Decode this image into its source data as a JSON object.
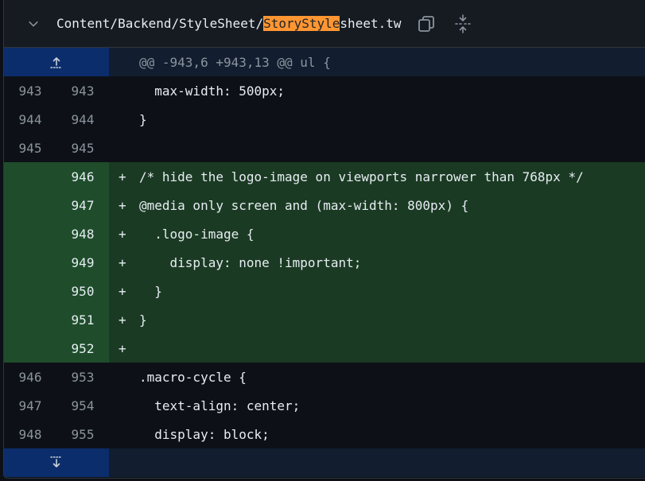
{
  "header": {
    "path_prefix": "Content/Backend/StyleSheet/",
    "path_highlight": "StoryStyle",
    "path_suffix": "sheet.tw",
    "icons": {
      "collapse": "chevron-down-icon",
      "copy": "copy-icon",
      "expand": "unfold-icon"
    }
  },
  "hunk": {
    "text": "@@ -943,6 +943,13 @@ ul {"
  },
  "lines": [
    {
      "type": "ctx",
      "old": "943",
      "new": "943",
      "marker": "",
      "text": "  max-width: 500px;"
    },
    {
      "type": "ctx",
      "old": "944",
      "new": "944",
      "marker": "",
      "text": "}"
    },
    {
      "type": "ctx",
      "old": "945",
      "new": "945",
      "marker": "",
      "text": ""
    },
    {
      "type": "add",
      "old": "",
      "new": "946",
      "marker": "+",
      "text": "/* hide the logo-image on viewports narrower than 768px */"
    },
    {
      "type": "add",
      "old": "",
      "new": "947",
      "marker": "+",
      "text": "@media only screen and (max-width: 800px) {"
    },
    {
      "type": "add",
      "old": "",
      "new": "948",
      "marker": "+",
      "text": "  .logo-image {"
    },
    {
      "type": "add",
      "old": "",
      "new": "949",
      "marker": "+",
      "text": "    display: none !important;"
    },
    {
      "type": "add",
      "old": "",
      "new": "950",
      "marker": "+",
      "text": "  }"
    },
    {
      "type": "add",
      "old": "",
      "new": "951",
      "marker": "+",
      "text": "}"
    },
    {
      "type": "add",
      "old": "",
      "new": "952",
      "marker": "+",
      "text": ""
    },
    {
      "type": "ctx",
      "old": "946",
      "new": "953",
      "marker": "",
      "text": ".macro-cycle {"
    },
    {
      "type": "ctx",
      "old": "947",
      "new": "954",
      "marker": "",
      "text": "  text-align: center;"
    },
    {
      "type": "ctx",
      "old": "948",
      "new": "955",
      "marker": "",
      "text": "  display: block;"
    }
  ]
}
